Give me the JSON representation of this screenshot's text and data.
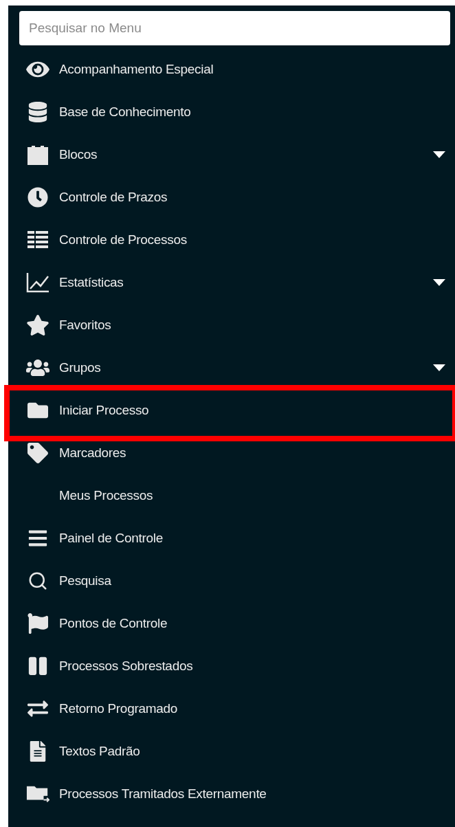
{
  "search": {
    "placeholder": "Pesquisar no Menu"
  },
  "menu": [
    {
      "label": "Acompanhamento Especial",
      "submenu": false,
      "highlighted": false
    },
    {
      "label": "Base de Conhecimento",
      "submenu": false,
      "highlighted": false
    },
    {
      "label": "Blocos",
      "submenu": true,
      "highlighted": false
    },
    {
      "label": "Controle de Prazos",
      "submenu": false,
      "highlighted": false
    },
    {
      "label": "Controle de Processos",
      "submenu": false,
      "highlighted": false
    },
    {
      "label": "Estatísticas",
      "submenu": true,
      "highlighted": false
    },
    {
      "label": "Favoritos",
      "submenu": false,
      "highlighted": false
    },
    {
      "label": "Grupos",
      "submenu": true,
      "highlighted": false
    },
    {
      "label": "Iniciar Processo",
      "submenu": false,
      "highlighted": true
    },
    {
      "label": "Marcadores",
      "submenu": false,
      "highlighted": false
    },
    {
      "label": "Meus Processos",
      "submenu": false,
      "highlighted": false
    },
    {
      "label": "Painel de Controle",
      "submenu": false,
      "highlighted": false
    },
    {
      "label": "Pesquisa",
      "submenu": false,
      "highlighted": false
    },
    {
      "label": "Pontos de Controle",
      "submenu": false,
      "highlighted": false
    },
    {
      "label": "Processos Sobrestados",
      "submenu": false,
      "highlighted": false
    },
    {
      "label": "Retorno Programado",
      "submenu": false,
      "highlighted": false
    },
    {
      "label": "Textos Padrão",
      "submenu": false,
      "highlighted": false
    },
    {
      "label": "Processos Tramitados Externamente",
      "submenu": false,
      "highlighted": false
    }
  ]
}
